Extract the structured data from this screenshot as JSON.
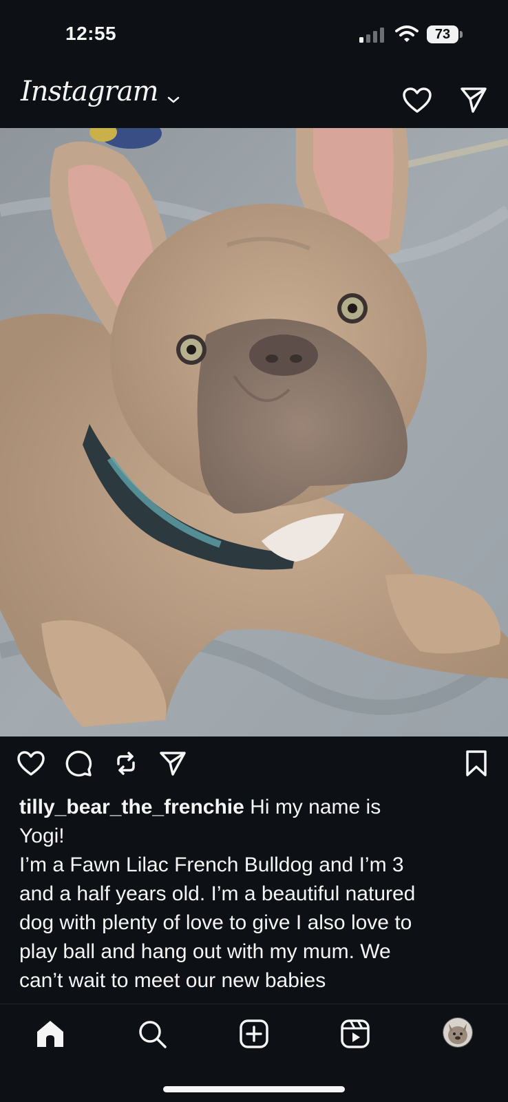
{
  "status": {
    "time": "12:55",
    "battery": "73"
  },
  "header": {
    "logo_text": "Instagram"
  },
  "post": {
    "username": "tilly_bear_the_frenchie",
    "caption_lines": [
      "Hi my name is",
      "Yogi!",
      "I’m a Fawn Lilac French Bulldog and I’m 3",
      "and a half years old. I’m a beautiful natured",
      "dog with plenty of love to give I also love to",
      "play ball and hang out with my mum. We",
      "can’t wait to meet our new babies"
    ]
  },
  "icons": {
    "header": [
      "heart-icon",
      "send-icon"
    ],
    "actions": [
      "like-icon",
      "comment-icon",
      "repost-icon",
      "share-icon",
      "save-icon"
    ],
    "tabs": [
      "home-icon",
      "search-icon",
      "create-icon",
      "reels-icon",
      "profile-avatar"
    ]
  },
  "colors": {
    "background": "#0d1014",
    "text": "#f5f5f5"
  }
}
